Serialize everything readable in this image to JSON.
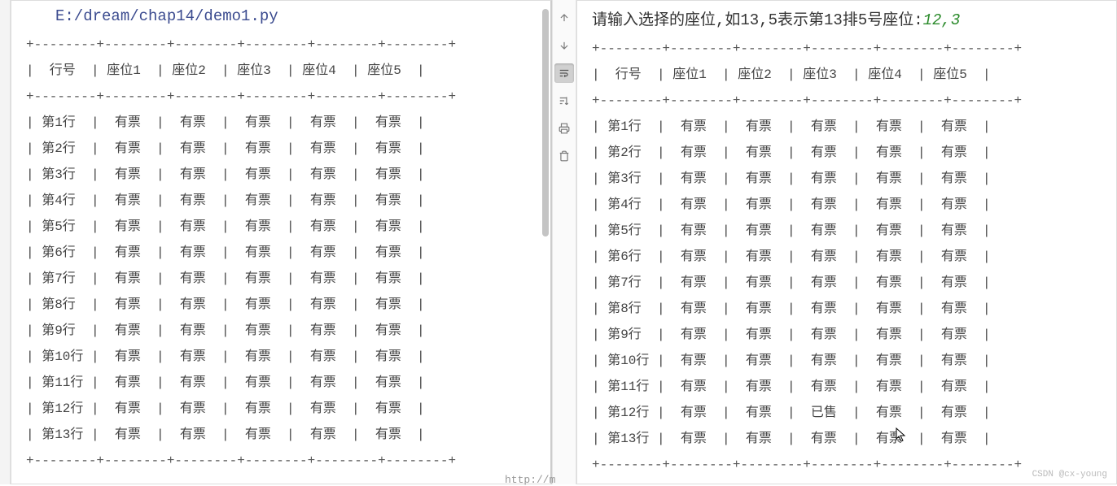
{
  "filepath": "E:/dream/chap14/demo1.py",
  "prompt": "请输入选择的座位,如13,5表示第13排5号座位:",
  "input_value": "12,3",
  "url_hint": "http://m",
  "watermark": "CSDN @cx-young",
  "left_table": {
    "headers": [
      "行号",
      "座位1",
      "座位2",
      "座位3",
      "座位4",
      "座位5"
    ],
    "rows": [
      {
        "label": "第1行",
        "cells": [
          "有票",
          "有票",
          "有票",
          "有票",
          "有票"
        ]
      },
      {
        "label": "第2行",
        "cells": [
          "有票",
          "有票",
          "有票",
          "有票",
          "有票"
        ]
      },
      {
        "label": "第3行",
        "cells": [
          "有票",
          "有票",
          "有票",
          "有票",
          "有票"
        ]
      },
      {
        "label": "第4行",
        "cells": [
          "有票",
          "有票",
          "有票",
          "有票",
          "有票"
        ]
      },
      {
        "label": "第5行",
        "cells": [
          "有票",
          "有票",
          "有票",
          "有票",
          "有票"
        ]
      },
      {
        "label": "第6行",
        "cells": [
          "有票",
          "有票",
          "有票",
          "有票",
          "有票"
        ]
      },
      {
        "label": "第7行",
        "cells": [
          "有票",
          "有票",
          "有票",
          "有票",
          "有票"
        ]
      },
      {
        "label": "第8行",
        "cells": [
          "有票",
          "有票",
          "有票",
          "有票",
          "有票"
        ]
      },
      {
        "label": "第9行",
        "cells": [
          "有票",
          "有票",
          "有票",
          "有票",
          "有票"
        ]
      },
      {
        "label": "第10行",
        "cells": [
          "有票",
          "有票",
          "有票",
          "有票",
          "有票"
        ]
      },
      {
        "label": "第11行",
        "cells": [
          "有票",
          "有票",
          "有票",
          "有票",
          "有票"
        ]
      },
      {
        "label": "第12行",
        "cells": [
          "有票",
          "有票",
          "有票",
          "有票",
          "有票"
        ]
      },
      {
        "label": "第13行",
        "cells": [
          "有票",
          "有票",
          "有票",
          "有票",
          "有票"
        ]
      }
    ]
  },
  "right_table": {
    "headers": [
      "行号",
      "座位1",
      "座位2",
      "座位3",
      "座位4",
      "座位5"
    ],
    "rows": [
      {
        "label": "第1行",
        "cells": [
          "有票",
          "有票",
          "有票",
          "有票",
          "有票"
        ]
      },
      {
        "label": "第2行",
        "cells": [
          "有票",
          "有票",
          "有票",
          "有票",
          "有票"
        ]
      },
      {
        "label": "第3行",
        "cells": [
          "有票",
          "有票",
          "有票",
          "有票",
          "有票"
        ]
      },
      {
        "label": "第4行",
        "cells": [
          "有票",
          "有票",
          "有票",
          "有票",
          "有票"
        ]
      },
      {
        "label": "第5行",
        "cells": [
          "有票",
          "有票",
          "有票",
          "有票",
          "有票"
        ]
      },
      {
        "label": "第6行",
        "cells": [
          "有票",
          "有票",
          "有票",
          "有票",
          "有票"
        ]
      },
      {
        "label": "第7行",
        "cells": [
          "有票",
          "有票",
          "有票",
          "有票",
          "有票"
        ]
      },
      {
        "label": "第8行",
        "cells": [
          "有票",
          "有票",
          "有票",
          "有票",
          "有票"
        ]
      },
      {
        "label": "第9行",
        "cells": [
          "有票",
          "有票",
          "有票",
          "有票",
          "有票"
        ]
      },
      {
        "label": "第10行",
        "cells": [
          "有票",
          "有票",
          "有票",
          "有票",
          "有票"
        ]
      },
      {
        "label": "第11行",
        "cells": [
          "有票",
          "有票",
          "有票",
          "有票",
          "有票"
        ]
      },
      {
        "label": "第12行",
        "cells": [
          "有票",
          "有票",
          "已售",
          "有票",
          "有票"
        ]
      },
      {
        "label": "第13行",
        "cells": [
          "有票",
          "有票",
          "有票",
          "有票",
          "有票"
        ]
      }
    ]
  },
  "toolbar": {
    "items": [
      "arrow-up",
      "arrow-down",
      "wrap",
      "sort",
      "print",
      "trash"
    ]
  }
}
